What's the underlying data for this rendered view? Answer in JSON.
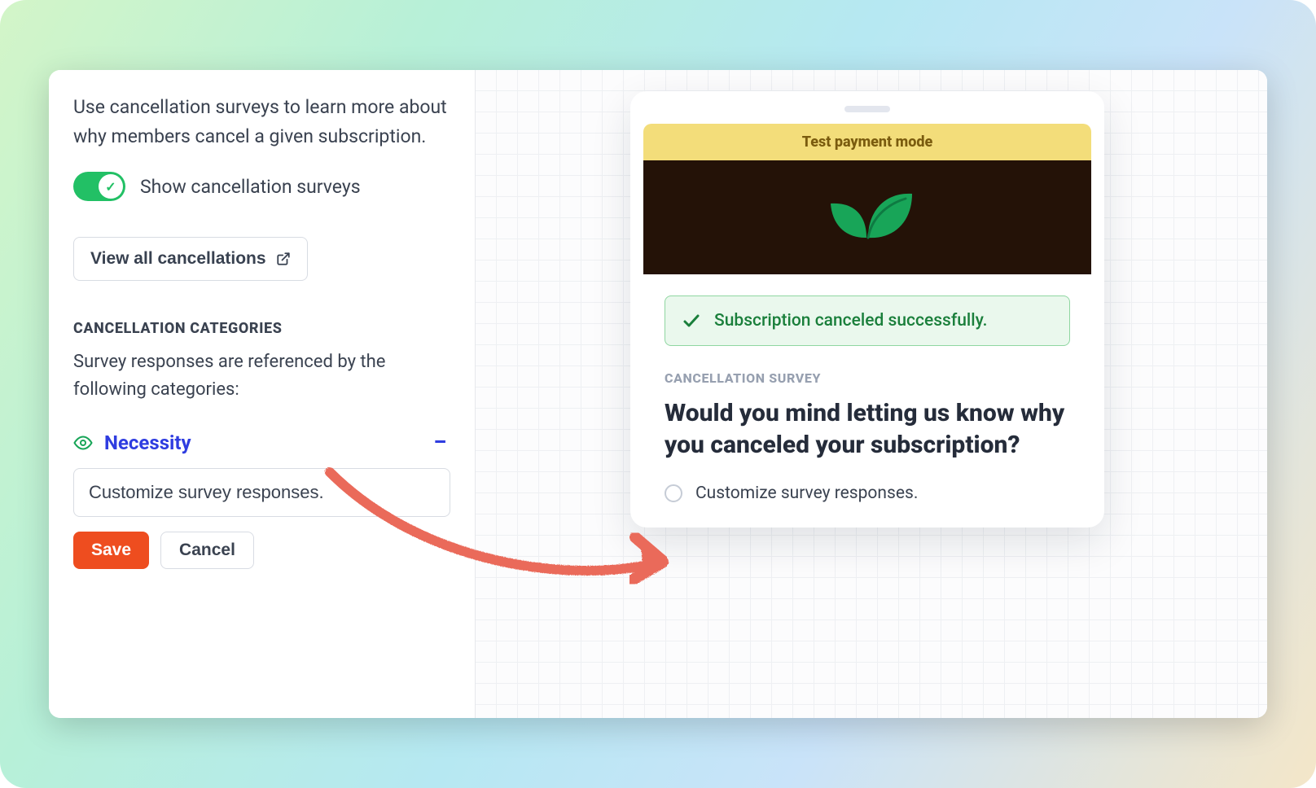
{
  "left": {
    "intro": "Use cancellation surveys to learn more about why members cancel a given subscription.",
    "toggle_label": "Show cancellation surveys",
    "view_all_label": "View all cancellations",
    "section_label": "CANCELLATION CATEGORIES",
    "section_sub": "Survey responses are referenced by the following categories:",
    "category_name": "Necessity",
    "response_value": "Customize survey responses.",
    "save_label": "Save",
    "cancel_label": "Cancel"
  },
  "preview": {
    "badge": "Test payment mode",
    "success_msg": "Subscription canceled successfully.",
    "survey_label": "CANCELLATION SURVEY",
    "survey_title": "Would you mind letting us know why you canceled your subscription?",
    "option1": "Customize survey responses."
  }
}
